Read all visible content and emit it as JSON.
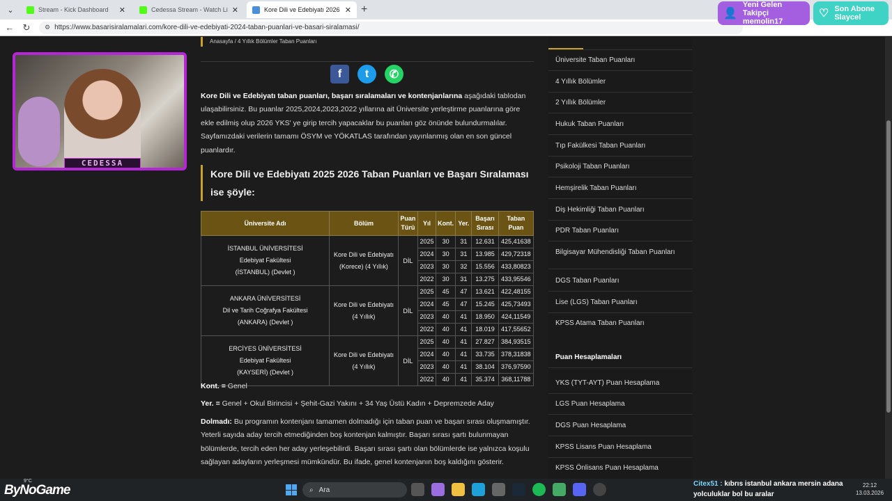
{
  "browser": {
    "tabs": [
      {
        "title": "Stream - Kick Dashboard",
        "color": "#53fc18",
        "active": false
      },
      {
        "title": "Cedessa Stream - Watch Live on K",
        "color": "#53fc18",
        "active": false
      },
      {
        "title": "Kore Dili ve Edebiyatı 2026 Tercih",
        "color": "#4a8fd8",
        "active": true
      }
    ],
    "url": "https://www.basarisiralamalari.com/kore-dili-ve-edebiyati-2024-taban-puanlari-ve-basari-siralamasi/"
  },
  "overlay": {
    "follower_title": "Yeni Gelen Takipçi",
    "follower_name": "memolin17",
    "sub_title": "Son Abone",
    "sub_name": "Slaycel",
    "cam_label": "CEDESSA"
  },
  "breadcrumb": "Anasayfa / 4 Yıllık Bölümler Taban Puanları",
  "intro": {
    "bold": "Kore Dili ve Edebiyatı taban puanları, başarı sıralamaları ve kontenjanlarına",
    "rest": " aşağıdaki tablodan ulaşabilirsiniz. Bu puanlar 2025,2024,2023,2022 yıllarına ait Üniversite yerleştirme puanlarına göre ekle edilmiş olup 2026 YKS' ye girip tercih yapacaklar bu puanları göz önünde bulundurmalılar. Sayfamızdaki verilerin tamamı ÖSYM ve YÖKATLAS tarafından yayınlanmış olan en son güncel puanlardır."
  },
  "heading": "Kore Dili ve Edebiyatı 2025 2026 Taban Puanları ve Başarı Sıralaması ise şöyle:",
  "table": {
    "headers": [
      "Üniversite Adı",
      "Bölüm",
      "Puan Türü",
      "Yıl",
      "Kont.",
      "Yer.",
      "Başarı Sırası",
      "Taban Puan"
    ],
    "rows": [
      {
        "uni_name": "İSTANBUL ÜNİVERSİTESİ",
        "faculty": "Edebiyat Fakültesi",
        "city": "(İSTANBUL) (Devlet )",
        "bolum_1": "Kore Dili ve Edebiyatı",
        "bolum_2": "(Korece) (4 Yıllık)",
        "puan_turu": "DİL",
        "years": [
          {
            "yil": "2025",
            "kont": "30",
            "yer": "31",
            "sira": "12.631",
            "puan": "425,41638"
          },
          {
            "yil": "2024",
            "kont": "30",
            "yer": "31",
            "sira": "13.985",
            "puan": "429,72318"
          },
          {
            "yil": "2023",
            "kont": "30",
            "yer": "32",
            "sira": "15.556",
            "puan": "433,80823"
          },
          {
            "yil": "2022",
            "kont": "30",
            "yer": "31",
            "sira": "13.275",
            "puan": "433,95546"
          }
        ]
      },
      {
        "uni_name": "ANKARA ÜNİVERSİTESİ",
        "faculty": "Dil ve Tarih Coğrafya Fakültesi",
        "city": "(ANKARA) (Devlet )",
        "bolum_1": "Kore Dili ve Edebiyatı",
        "bolum_2": "(4 Yıllık)",
        "puan_turu": "DİL",
        "years": [
          {
            "yil": "2025",
            "kont": "45",
            "yer": "47",
            "sira": "13.621",
            "puan": "422,48155"
          },
          {
            "yil": "2024",
            "kont": "45",
            "yer": "47",
            "sira": "15.245",
            "puan": "425,73493"
          },
          {
            "yil": "2023",
            "kont": "40",
            "yer": "41",
            "sira": "18.950",
            "puan": "424,11549"
          },
          {
            "yil": "2022",
            "kont": "40",
            "yer": "41",
            "sira": "18.019",
            "puan": "417,55652"
          }
        ]
      },
      {
        "uni_name": "ERCİYES ÜNİVERSİTESİ",
        "faculty": "Edebiyat Fakültesi",
        "city": "(KAYSERİ) (Devlet )",
        "bolum_1": "Kore Dili ve Edebiyatı",
        "bolum_2": "(4 Yıllık)",
        "puan_turu": "DİL",
        "years": [
          {
            "yil": "2025",
            "kont": "40",
            "yer": "41",
            "sira": "27.827",
            "puan": "384,93515"
          },
          {
            "yil": "2024",
            "kont": "40",
            "yer": "41",
            "sira": "33.735",
            "puan": "378,31838"
          },
          {
            "yil": "2023",
            "kont": "40",
            "yer": "41",
            "sira": "38.104",
            "puan": "376,97590"
          },
          {
            "yil": "2022",
            "kont": "40",
            "yer": "41",
            "sira": "35.374",
            "puan": "368,11788"
          }
        ]
      }
    ]
  },
  "notes": {
    "kont_label": "Kont. =",
    "kont_text": " Genel",
    "yer_label": "Yer. =",
    "yer_text": " Genel + Okul Birincisi + Şehit-Gazi Yakını + 34 Yaş Üstü Kadın + Depremzede Aday",
    "dolmadi_label": "Dolmadı:",
    "dolmadi_text": " Bu programın kontenjanı tamamen dolmadığı için taban puan ve başarı sırası oluşmamıştır. Yeterli sayıda aday tercih etmediğinden boş kontenjan kalmıştır. Başarı sırası şartı bulunmayan bölümlerde, tercih eden her aday yerleşebilirdi. Başarı sırası şartı olan bölümlerde ise yalnızca koşulu sağlayan adayların yerleşmesi mümkündür. Bu ifade, genel kontenjanın boş kaldığını gösterir."
  },
  "sidebar": {
    "links": [
      "Üniversite Taban Puanları",
      "4 Yıllık Bölümler",
      "2 Yıllık Bölümler",
      "Hukuk Taban Puanları",
      "Tıp Fakülkesi Taban Puanları",
      "Psikoloji Taban Puanları",
      "Hemşirelik Taban Puanları",
      "Diş Hekimliği Taban Puanları",
      "PDR Taban Puanları",
      "Bilgisayar Mühendisliği Taban Puanları",
      "DGS Taban Puanları",
      "Lise (LGS) Taban Puanları",
      "KPSS Atama Taban Puanları"
    ],
    "section2_title": "Puan Hesaplamaları",
    "calc_links": [
      "YKS (TYT-AYT) Puan Hesaplama",
      "LGS Puan Hesaplama",
      "DGS Puan Hesaplama",
      "KPSS Lisans Puan Hesaplama",
      "KPSS Önlisans Puan Hesaplama"
    ]
  },
  "taskbar": {
    "brand": "ByNoGame",
    "temp": "9°C",
    "search": "Ara",
    "chat_user": "Citex51 :",
    "chat_msg": " kıbrıs istanbul ankara mersin adana yolculuklar bol bu aralar",
    "time": "22:12",
    "date": "13.03.2026"
  }
}
